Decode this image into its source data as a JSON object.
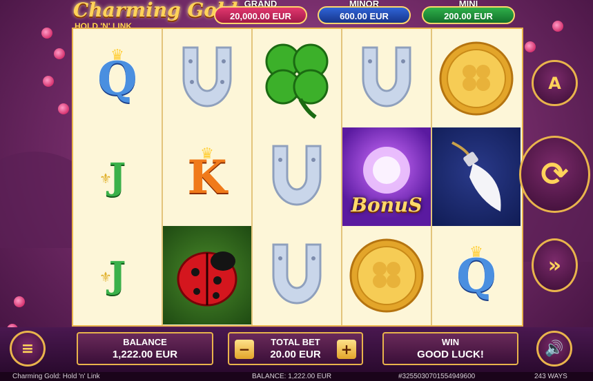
{
  "game": {
    "logo_line1": "Charming Gold",
    "logo_line2": "HOLD 'N' LINK"
  },
  "jackpots": [
    {
      "label": "GRAND",
      "value": "20,000.00 EUR",
      "color": "#c8285c"
    },
    {
      "label": "MINOR",
      "value": "600.00 EUR",
      "color": "#2448b0"
    },
    {
      "label": "MINI",
      "value": "200.00 EUR",
      "color": "#1e8a36"
    }
  ],
  "reels": [
    [
      "Q",
      "J",
      "J"
    ],
    [
      "horseshoe",
      "K",
      "ladybug"
    ],
    [
      "clover",
      "horseshoe",
      "horseshoe"
    ],
    [
      "horseshoe",
      "Bonus",
      "gold-coin"
    ],
    [
      "gold-coin",
      "rabbit-foot",
      "Q"
    ]
  ],
  "bonus_label": "BonuS",
  "controls": {
    "balance_label": "BALANCE",
    "balance_value": "1,222.00 EUR",
    "bet_label": "TOTAL BET",
    "bet_value": "20.00 EUR",
    "bet_minus": "−",
    "bet_plus": "+",
    "win_label": "WIN",
    "win_value": "GOOD LUCK!",
    "autoplay_icon": "A",
    "spin_icon": "⟳",
    "turbo_icon": "»",
    "menu_icon": "≡",
    "sound_icon": "🔊"
  },
  "status": {
    "title": "Charming Gold: Hold 'n' Link",
    "balance": "BALANCE: 1,222.00 EUR",
    "round_id": "#32550307015549496​00",
    "ways": "243 WAYS"
  },
  "colors": {
    "accent_gold": "#e9b44c",
    "reel_bg": "#fdf6d8"
  }
}
